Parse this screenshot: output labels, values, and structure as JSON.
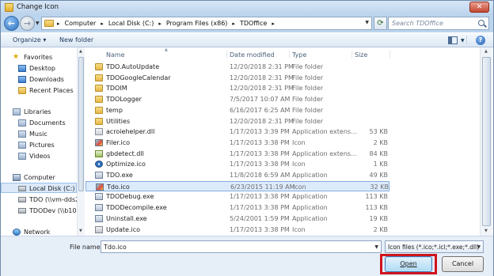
{
  "window": {
    "title": "Change Icon"
  },
  "nav": {
    "breadcrumb": [
      "Computer",
      "Local Disk (C:)",
      "Program Files (x86)",
      "TDOffice"
    ],
    "search_placeholder": "Search TDOffice"
  },
  "toolbar": {
    "organize": "Organize ▾",
    "new_folder": "New folder"
  },
  "sidebar": {
    "favorites": "Favorites",
    "desktop": "Desktop",
    "downloads": "Downloads",
    "recent": "Recent Places",
    "libraries": "Libraries",
    "documents": "Documents",
    "music": "Music",
    "pictures": "Pictures",
    "videos": "Videos",
    "computer": "Computer",
    "local_disk": "Local Disk (C:)",
    "tdo_net": "TDO (\\\\vm-dds2",
    "tdodev_net": "TDODev (\\\\b101c",
    "network": "Network"
  },
  "columns": {
    "name": "Name",
    "date": "Date modified",
    "type": "Type",
    "size": "Size"
  },
  "files": [
    {
      "name": "TDO.AutoUpdate",
      "date": "12/20/2018 2:31 PM",
      "type": "File folder",
      "size": "",
      "icon": "folder"
    },
    {
      "name": "TDOGoogleCalendar",
      "date": "12/20/2018 2:31 PM",
      "type": "File folder",
      "size": "",
      "icon": "folder"
    },
    {
      "name": "TDOIM",
      "date": "12/20/2018 2:31 PM",
      "type": "File folder",
      "size": "",
      "icon": "folder"
    },
    {
      "name": "TDOLogger",
      "date": "7/5/2017 10:07 AM",
      "type": "File folder",
      "size": "",
      "icon": "folder"
    },
    {
      "name": "temp",
      "date": "6/16/2017 6:25 AM",
      "type": "File folder",
      "size": "",
      "icon": "folder"
    },
    {
      "name": "Utilities",
      "date": "12/20/2018 2:31 PM",
      "type": "File folder",
      "size": "",
      "icon": "folder"
    },
    {
      "name": "acroiehelper.dll",
      "date": "1/17/2013 3:39 PM",
      "type": "Application extens...",
      "size": "53 KB",
      "icon": "dll"
    },
    {
      "name": "Filer.ico",
      "date": "1/17/2013 3:38 PM",
      "type": "Icon",
      "size": "2 KB",
      "icon": "ico"
    },
    {
      "name": "gbdetect.dll",
      "date": "1/17/2013 3:38 PM",
      "type": "Application extens...",
      "size": "84 KB",
      "icon": "dll2"
    },
    {
      "name": "Optimize.ico",
      "date": "1/17/2013 3:38 PM",
      "type": "Icon",
      "size": "1 KB",
      "icon": "ico2"
    },
    {
      "name": "TDO.exe",
      "date": "11/8/2018 6:59 AM",
      "type": "Application",
      "size": "49 KB",
      "icon": "exe"
    },
    {
      "name": "Tdo.ico",
      "date": "6/23/2015 11:19 AM",
      "type": "Icon",
      "size": "32 KB",
      "icon": "ico",
      "selected": true
    },
    {
      "name": "TDODebug.exe",
      "date": "1/17/2013 3:38 PM",
      "type": "Application",
      "size": "113 KB",
      "icon": "exe"
    },
    {
      "name": "TDODecompile.exe",
      "date": "1/17/2013 3:38 PM",
      "type": "Application",
      "size": "113 KB",
      "icon": "exe"
    },
    {
      "name": "Uninstall.exe",
      "date": "5/24/2001 1:59 PM",
      "type": "Application",
      "size": "19 KB",
      "icon": "exe"
    },
    {
      "name": "Update.ico",
      "date": "1/17/2013 3:38 PM",
      "type": "Icon",
      "size": "2 KB",
      "icon": "ico3"
    }
  ],
  "bottom": {
    "file_name_label": "File name:",
    "file_name_value": "Tdo.ico",
    "filter": "Icon files (*.ico;*.icl;*.exe;*.dll)",
    "open": "Open",
    "cancel": "Cancel"
  },
  "colors": {
    "highlight_outline": "#d0141c",
    "selection": "#dcebfc"
  }
}
